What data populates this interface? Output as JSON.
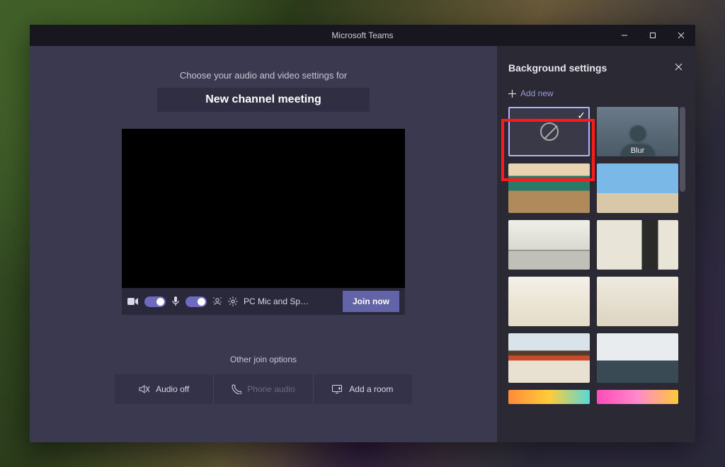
{
  "window": {
    "title": "Microsoft Teams"
  },
  "left": {
    "instruction": "Choose your audio and video settings for",
    "meeting_title": "New channel meeting",
    "toolbar": {
      "device_label": "PC Mic and Sp…",
      "join_label": "Join now"
    },
    "other_label": "Other join options",
    "options": {
      "audio_off": "Audio off",
      "phone_audio": "Phone audio",
      "add_room": "Add a room"
    }
  },
  "right": {
    "title": "Background settings",
    "add_new_label": "Add new",
    "items": {
      "none": {
        "selected": true
      },
      "blur": {
        "label": "Blur"
      }
    }
  }
}
